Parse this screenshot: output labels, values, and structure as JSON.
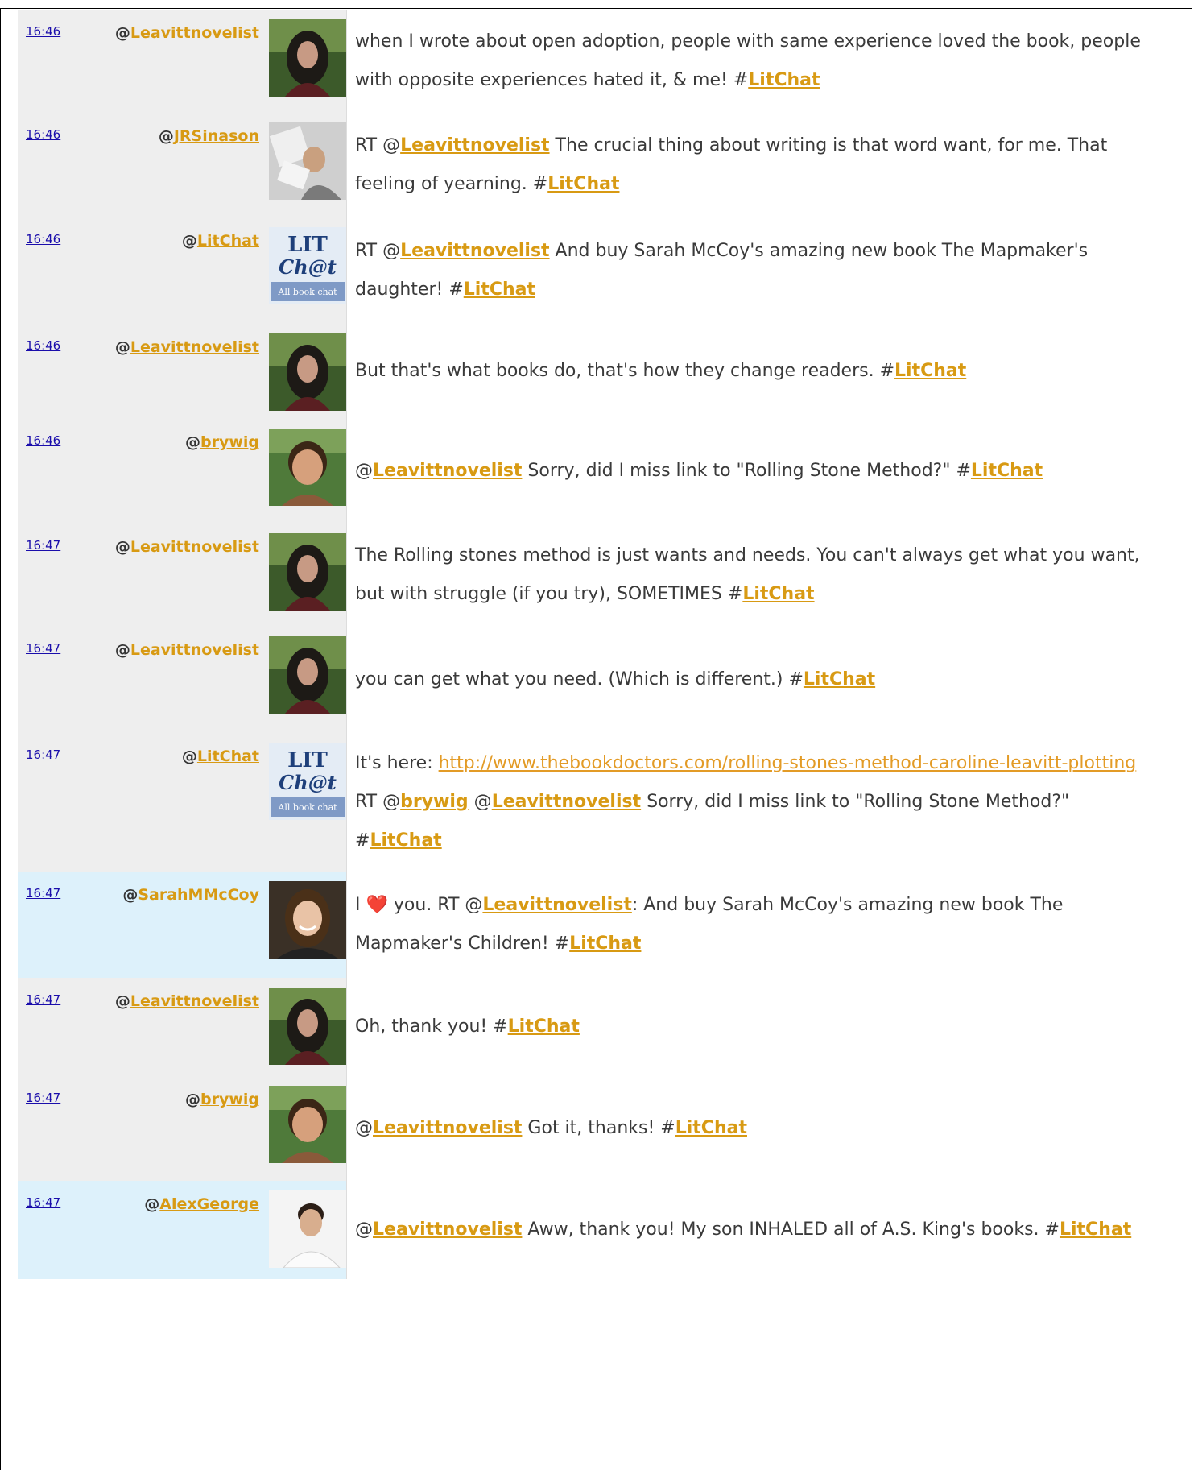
{
  "hashtag": "#LitChat",
  "tweets": [
    {
      "time": "16:46",
      "at": "@",
      "user": "Leavittnovelist",
      "avatar": "caroline-avatar",
      "highlight": false,
      "parts": [
        {
          "t": "text",
          "v": "when I wrote about open adoption, people with same experience loved the book, people with opposite experiences hated it, & me! #"
        },
        {
          "t": "tag",
          "v": "LitChat"
        }
      ]
    },
    {
      "time": "16:46",
      "at": "@",
      "user": "JRSinason",
      "avatar": "reader-avatar",
      "highlight": false,
      "parts": [
        {
          "t": "text",
          "v": "RT @"
        },
        {
          "t": "mention",
          "v": "Leavittnovelist"
        },
        {
          "t": "text",
          "v": " The crucial thing about writing is that word want, for me. That feeling of yearning. #"
        },
        {
          "t": "tag",
          "v": "LitChat"
        }
      ]
    },
    {
      "time": "16:46",
      "at": "@",
      "user": "LitChat",
      "avatar": "litchat-logo",
      "highlight": false,
      "parts": [
        {
          "t": "text",
          "v": "RT @"
        },
        {
          "t": "mention",
          "v": "Leavittnovelist"
        },
        {
          "t": "text",
          "v": " And buy Sarah McCoy's amazing new book The Mapmaker's daughter! #"
        },
        {
          "t": "tag",
          "v": "LitChat"
        }
      ]
    },
    {
      "time": "16:46",
      "at": "@",
      "user": "Leavittnovelist",
      "avatar": "caroline-avatar",
      "highlight": false,
      "parts": [
        {
          "t": "text",
          "v": "But that's what books do, that's how they change readers. #"
        },
        {
          "t": "tag",
          "v": "LitChat"
        }
      ]
    },
    {
      "time": "16:46",
      "at": "@",
      "user": "brywig",
      "avatar": "brywig-avatar",
      "highlight": false,
      "parts": [
        {
          "t": "text",
          "v": "@"
        },
        {
          "t": "mention",
          "v": "Leavittnovelist"
        },
        {
          "t": "text",
          "v": " Sorry, did I miss link to \"Rolling Stone Method?\" #"
        },
        {
          "t": "tag",
          "v": "LitChat"
        }
      ]
    },
    {
      "time": "16:47",
      "at": "@",
      "user": "Leavittnovelist",
      "avatar": "caroline-avatar",
      "highlight": false,
      "parts": [
        {
          "t": "text",
          "v": "The Rolling stones method is just wants and needs. You can't always get what you want, but with struggle (if you try), SOMETIMES #"
        },
        {
          "t": "tag",
          "v": "LitChat"
        }
      ]
    },
    {
      "time": "16:47",
      "at": "@",
      "user": "Leavittnovelist",
      "avatar": "caroline-avatar",
      "highlight": false,
      "parts": [
        {
          "t": "text",
          "v": "you can get what you need. (Which is different.) #"
        },
        {
          "t": "tag",
          "v": "LitChat"
        }
      ]
    },
    {
      "time": "16:47",
      "at": "@",
      "user": "LitChat",
      "avatar": "litchat-logo",
      "highlight": false,
      "parts": [
        {
          "t": "text",
          "v": "It's here: "
        },
        {
          "t": "link",
          "v": "http://www.thebookdoctors.com/rolling-stones-method-caroline-leavitt-plotting"
        },
        {
          "t": "text",
          "v": " RT @"
        },
        {
          "t": "mention",
          "v": "brywig"
        },
        {
          "t": "text",
          "v": " @"
        },
        {
          "t": "mention",
          "v": "Leavittnovelist"
        },
        {
          "t": "text",
          "v": " Sorry, did I miss link to \"Rolling Stone Method?\" #"
        },
        {
          "t": "tag",
          "v": "LitChat"
        }
      ]
    },
    {
      "time": "16:47",
      "at": "@",
      "user": "SarahMMcCoy",
      "avatar": "sarah-avatar",
      "highlight": true,
      "parts": [
        {
          "t": "text",
          "v": "I ❤️ you. RT @"
        },
        {
          "t": "mention",
          "v": "Leavittnovelist"
        },
        {
          "t": "text",
          "v": ": And buy Sarah McCoy's amazing new book The Mapmaker's Children! #"
        },
        {
          "t": "tag",
          "v": "LitChat"
        }
      ]
    },
    {
      "time": "16:47",
      "at": "@",
      "user": "Leavittnovelist",
      "avatar": "caroline-avatar",
      "highlight": false,
      "parts": [
        {
          "t": "text",
          "v": "Oh, thank you! #"
        },
        {
          "t": "tag",
          "v": "LitChat"
        }
      ]
    },
    {
      "time": "16:47",
      "at": "@",
      "user": "brywig",
      "avatar": "brywig-avatar",
      "highlight": false,
      "parts": [
        {
          "t": "text",
          "v": "@"
        },
        {
          "t": "mention",
          "v": "Leavittnovelist"
        },
        {
          "t": "text",
          "v": " Got it, thanks! #"
        },
        {
          "t": "tag",
          "v": "LitChat"
        }
      ]
    },
    {
      "time": "16:47",
      "at": "@",
      "user": "AlexGeorge",
      "avatar": "alex-avatar",
      "highlight": true,
      "parts": [
        {
          "t": "text",
          "v": "@"
        },
        {
          "t": "mention",
          "v": "Leavittnovelist"
        },
        {
          "t": "text",
          "v": " Aww, thank you! My son INHALED all of A.S. King's books. #"
        },
        {
          "t": "tag",
          "v": "LitChat"
        }
      ]
    }
  ]
}
